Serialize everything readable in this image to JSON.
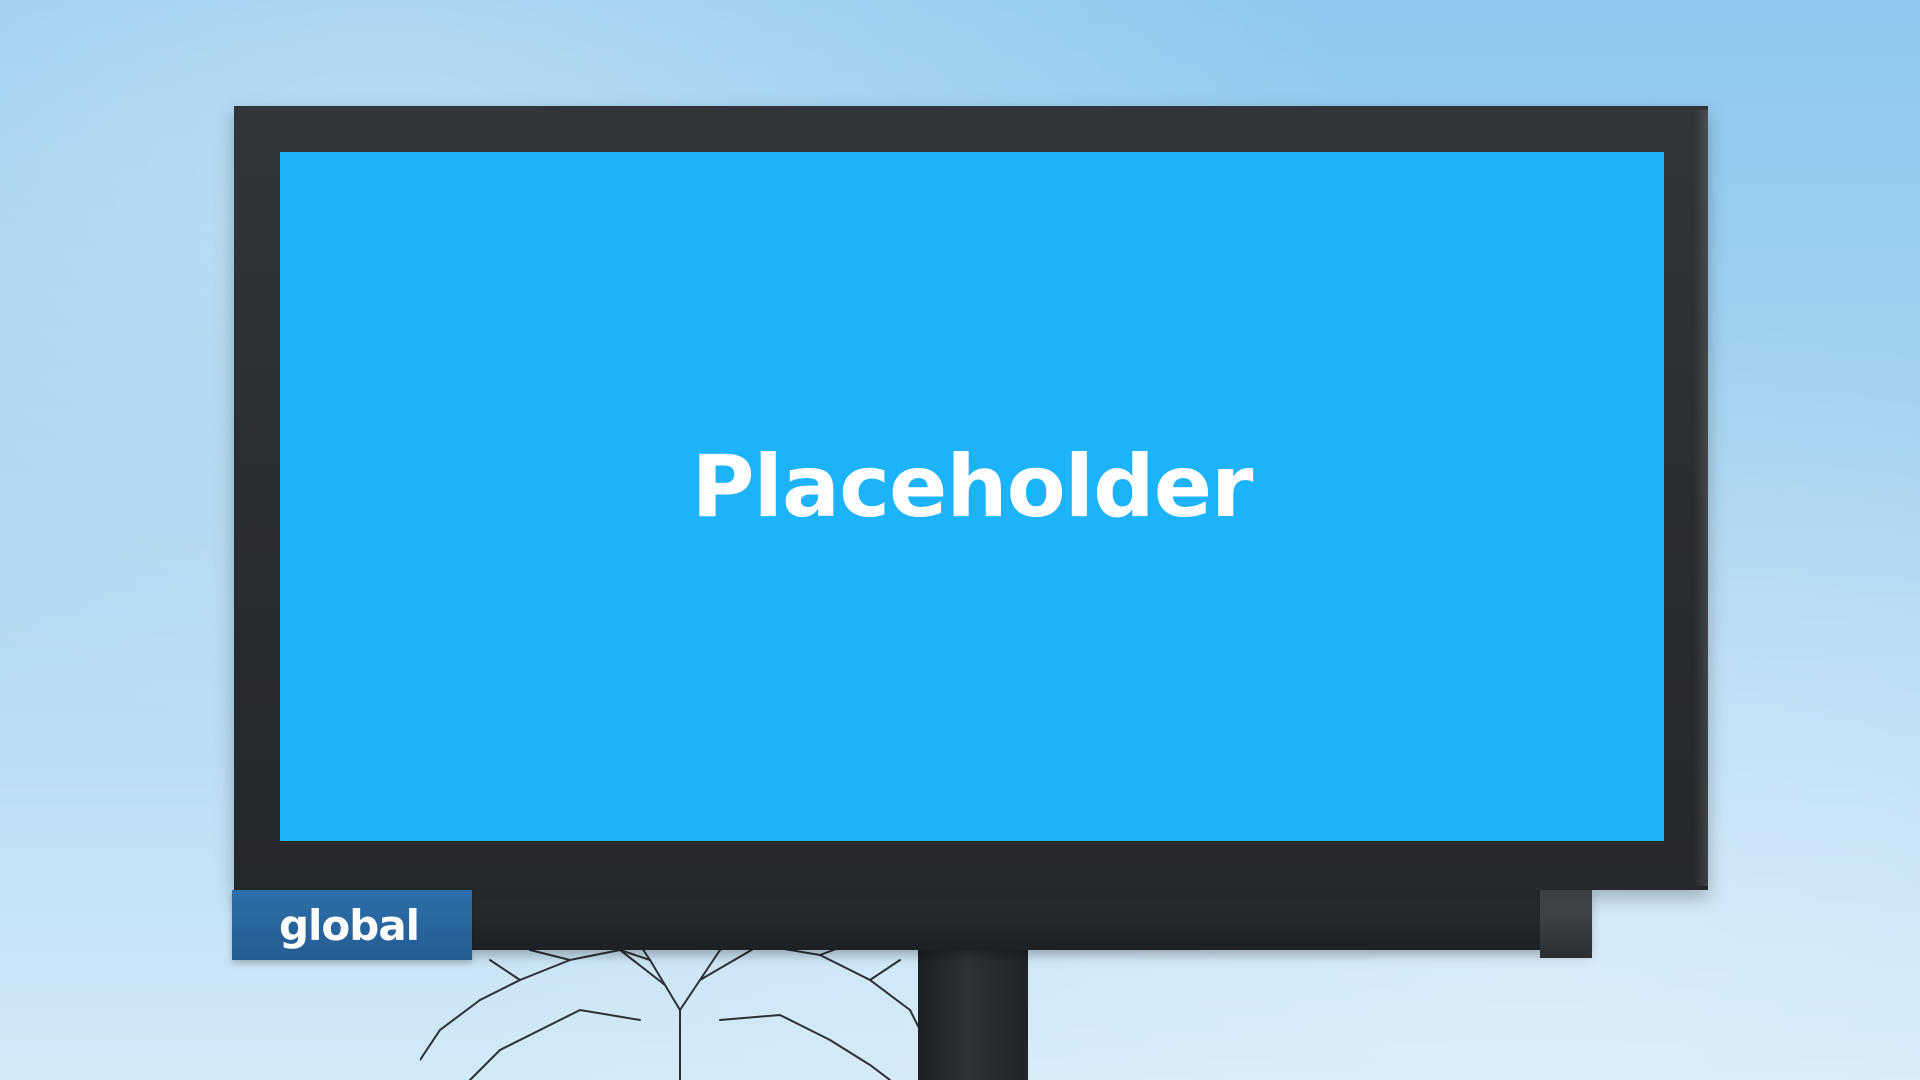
{
  "billboard": {
    "screen_text": "Placeholder",
    "screen_color": "#1cb3f9",
    "frame_color": "#2a2d31"
  },
  "logo": {
    "text": "global",
    "plate_color": "#2a66a0"
  },
  "sky": {
    "color_top": "#8ec8ee",
    "color_bottom": "#d2e9f7"
  }
}
